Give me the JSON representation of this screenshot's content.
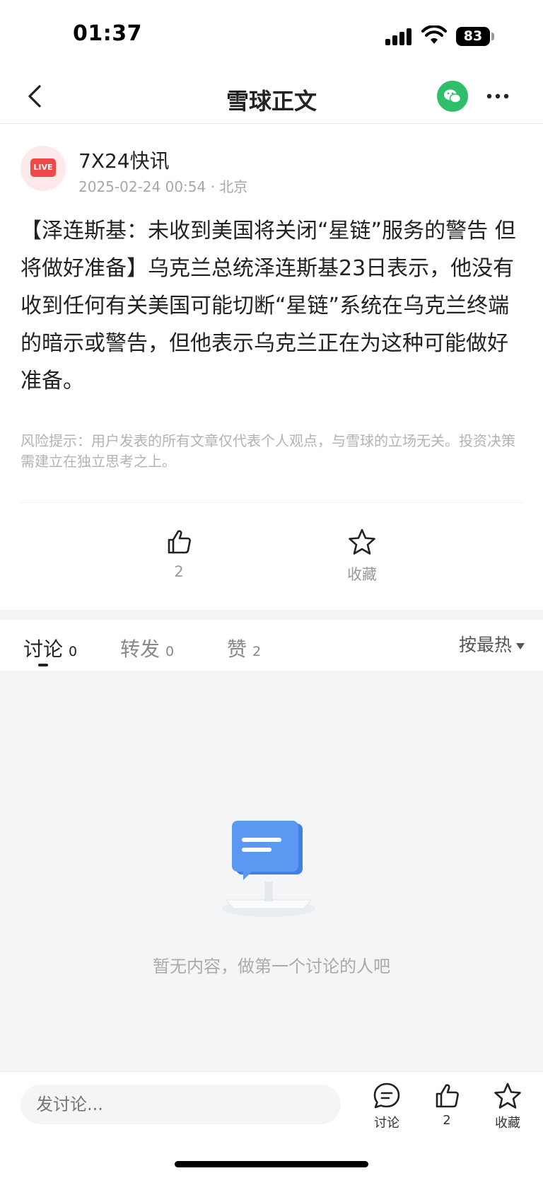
{
  "status_bar": {
    "time": "01:37",
    "battery": "83"
  },
  "nav": {
    "title": "雪球正文"
  },
  "post": {
    "avatar_text": "LIVE",
    "author": "7X24快讯",
    "meta": "2025-02-24 00:54 · 北京",
    "content": "【泽连斯基：未收到美国将关闭“星链”服务的警告 但将做好准备】乌克兰总统泽连斯基23日表示，他没有收到任何有关美国可能切断“星链”系统在乌克兰终端的暗示或警告，但他表示乌克兰正在为这种可能做好准备。",
    "risk_notice": "风险提示：用户发表的所有文章仅代表个人观点，与雪球的立场无关。投资决策需建立在独立思考之上。"
  },
  "actions": {
    "like_count": "2",
    "favorite_label": "收藏"
  },
  "tabs": [
    {
      "label": "讨论",
      "count": "0"
    },
    {
      "label": "转发",
      "count": "0"
    },
    {
      "label": "赞",
      "count": "2"
    }
  ],
  "sort_label": "按最热",
  "empty_text": "暂无内容，做第一个讨论的人吧",
  "bottom_bar": {
    "input_placeholder": "发讨论...",
    "discuss_label": "讨论",
    "like_count": "2",
    "favorite_label": "收藏"
  },
  "colors": {
    "wechat": "#2fbf6b",
    "live_red": "#f04848",
    "illustration_blue": "#4a8af0"
  }
}
